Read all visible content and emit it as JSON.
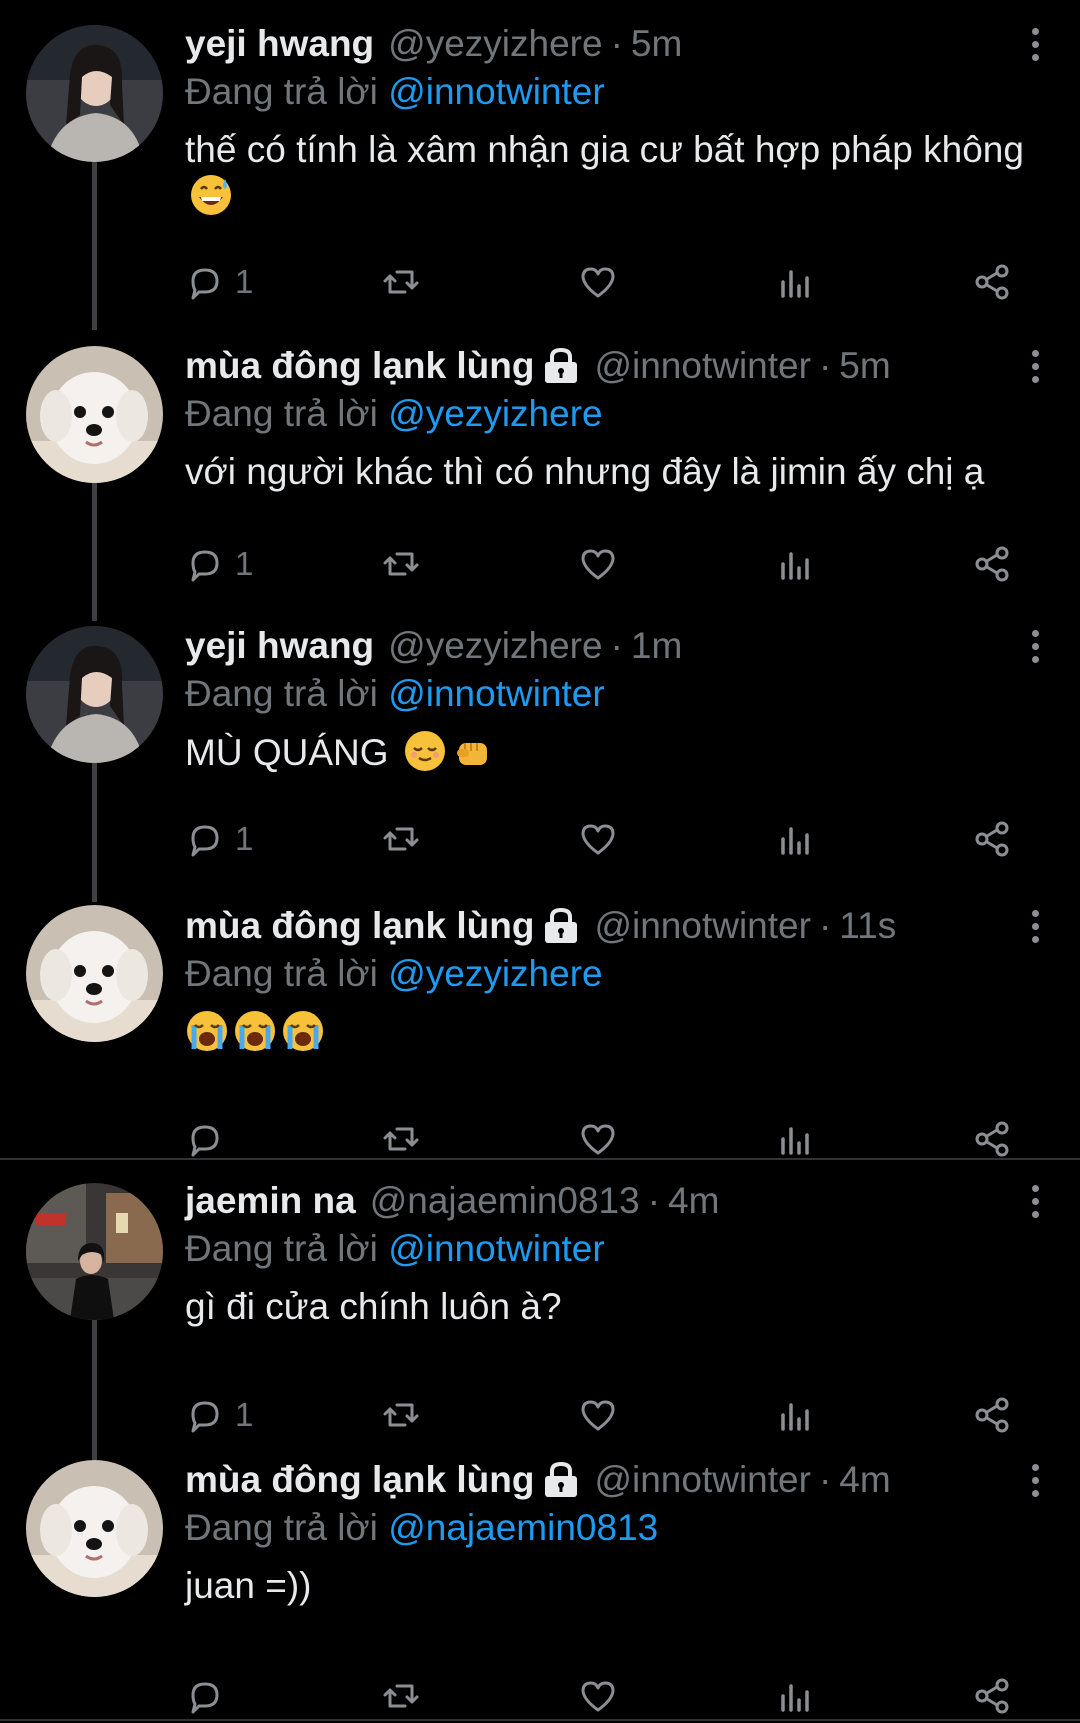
{
  "colors": {
    "background": "#000000",
    "text": "#e7e9ea",
    "muted": "#71767b",
    "link": "#1d9bf0"
  },
  "reply_prefix": "Đang trả lời",
  "tweets": [
    {
      "name": "yeji hwang",
      "locked": false,
      "handle": "@yezyizhere",
      "time": "5m",
      "reply_to": "@innotwinter",
      "text": "thế có tính là xâm nhận gia cư bất hợp pháp không",
      "emojis": [
        "grinning-sweat-emoji"
      ],
      "reply_count": "1"
    },
    {
      "name": "mùa đông lạnk lùng",
      "locked": true,
      "handle": "@innotwinter",
      "time": "5m",
      "reply_to": "@yezyizhere",
      "text": "với người khác thì có nhưng đây là jimin ấy chị ạ",
      "emojis": [],
      "reply_count": "1"
    },
    {
      "name": "yeji hwang",
      "locked": false,
      "handle": "@yezyizhere",
      "time": "1m",
      "reply_to": "@innotwinter",
      "text": "MÙ QUÁNG",
      "emojis": [
        "relieved-face-emoji",
        "fist-emoji"
      ],
      "reply_count": "1"
    },
    {
      "name": "mùa đông lạnk lùng",
      "locked": true,
      "handle": "@innotwinter",
      "time": "11s",
      "reply_to": "@yezyizhere",
      "text": "",
      "emojis": [
        "crying-face-emoji",
        "crying-face-emoji",
        "crying-face-emoji"
      ],
      "reply_count": ""
    },
    {
      "name": "jaemin na",
      "locked": false,
      "handle": "@najaemin0813",
      "time": "4m",
      "reply_to": "@innotwinter",
      "text": "gì đi cửa chính luôn à?",
      "emojis": [],
      "reply_count": "1"
    },
    {
      "name": "mùa đông lạnk lùng",
      "locked": true,
      "handle": "@innotwinter",
      "time": "4m",
      "reply_to": "@najaemin0813",
      "text": "juan =))",
      "emojis": [],
      "reply_count": ""
    }
  ],
  "icons": {
    "reply": "reply-icon",
    "retweet": "retweet-icon",
    "like": "heart-icon",
    "views": "analytics-icon",
    "share": "share-icon",
    "more": "more-icon",
    "lock": "lock-icon"
  }
}
